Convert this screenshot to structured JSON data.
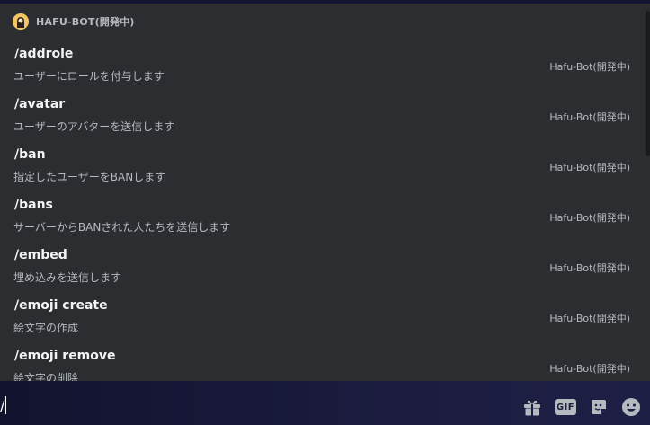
{
  "autocomplete": {
    "header_title": "HAFU-BOT(開発中)",
    "bot_avatar_icon": "bot-avatar-icon",
    "commands": [
      {
        "name": "/addrole",
        "description": "ユーザーにロールを付与します",
        "source": "Hafu-Bot(開発中)"
      },
      {
        "name": "/avatar",
        "description": "ユーザーのアバターを送信します",
        "source": "Hafu-Bot(開発中)"
      },
      {
        "name": "/ban",
        "description": "指定したユーザーをBANします",
        "source": "Hafu-Bot(開発中)"
      },
      {
        "name": "/bans",
        "description": "サーバーからBANされた人たちを送信します",
        "source": "Hafu-Bot(開発中)"
      },
      {
        "name": "/embed",
        "description": "埋め込みを送信します",
        "source": "Hafu-Bot(開発中)"
      },
      {
        "name": "/emoji create",
        "description": "絵文字の作成",
        "source": "Hafu-Bot(開発中)"
      },
      {
        "name": "/emoji remove",
        "description": "絵文字の削除",
        "source": "Hafu-Bot(開発中)"
      }
    ]
  },
  "chat_bar": {
    "input_value": "/",
    "gif_label": "GIF",
    "icons": [
      "gift-icon",
      "gif-icon",
      "sticker-icon",
      "emoji-icon"
    ]
  },
  "colors": {
    "popup_bg": "#2b2d31",
    "chat_bar_bg": "#1b1c3f",
    "command_name": "#f2f3f5",
    "secondary_text": "#b5bac1"
  }
}
